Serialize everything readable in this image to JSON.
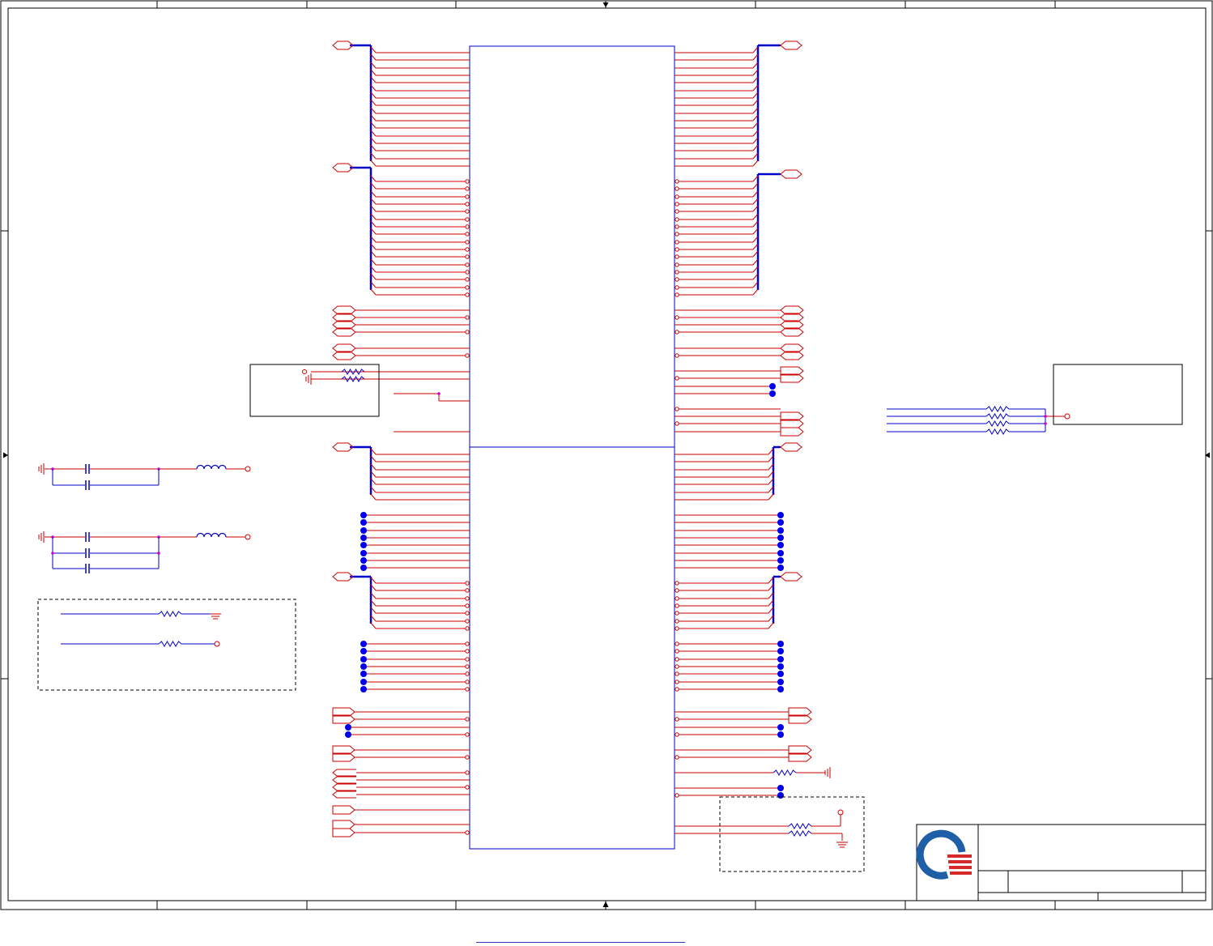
{
  "colors": {
    "frame": "#000000",
    "wire": "#cc0000",
    "bus": "#0000cc",
    "component": "#0000cc",
    "junction": "#0000ee",
    "pin": "#cc0000",
    "node": "#cc00cc",
    "logo_blue": "#1f5fa8",
    "logo_red": "#d42a2a"
  },
  "icons": {
    "logo": "company-logo-icon",
    "ground": "ground-icon",
    "resistor": "resistor-icon",
    "inductor": "inductor-icon",
    "capacitor": "capacitor-icon"
  },
  "title_block": {
    "title": "",
    "sheet": "",
    "rev": ""
  }
}
